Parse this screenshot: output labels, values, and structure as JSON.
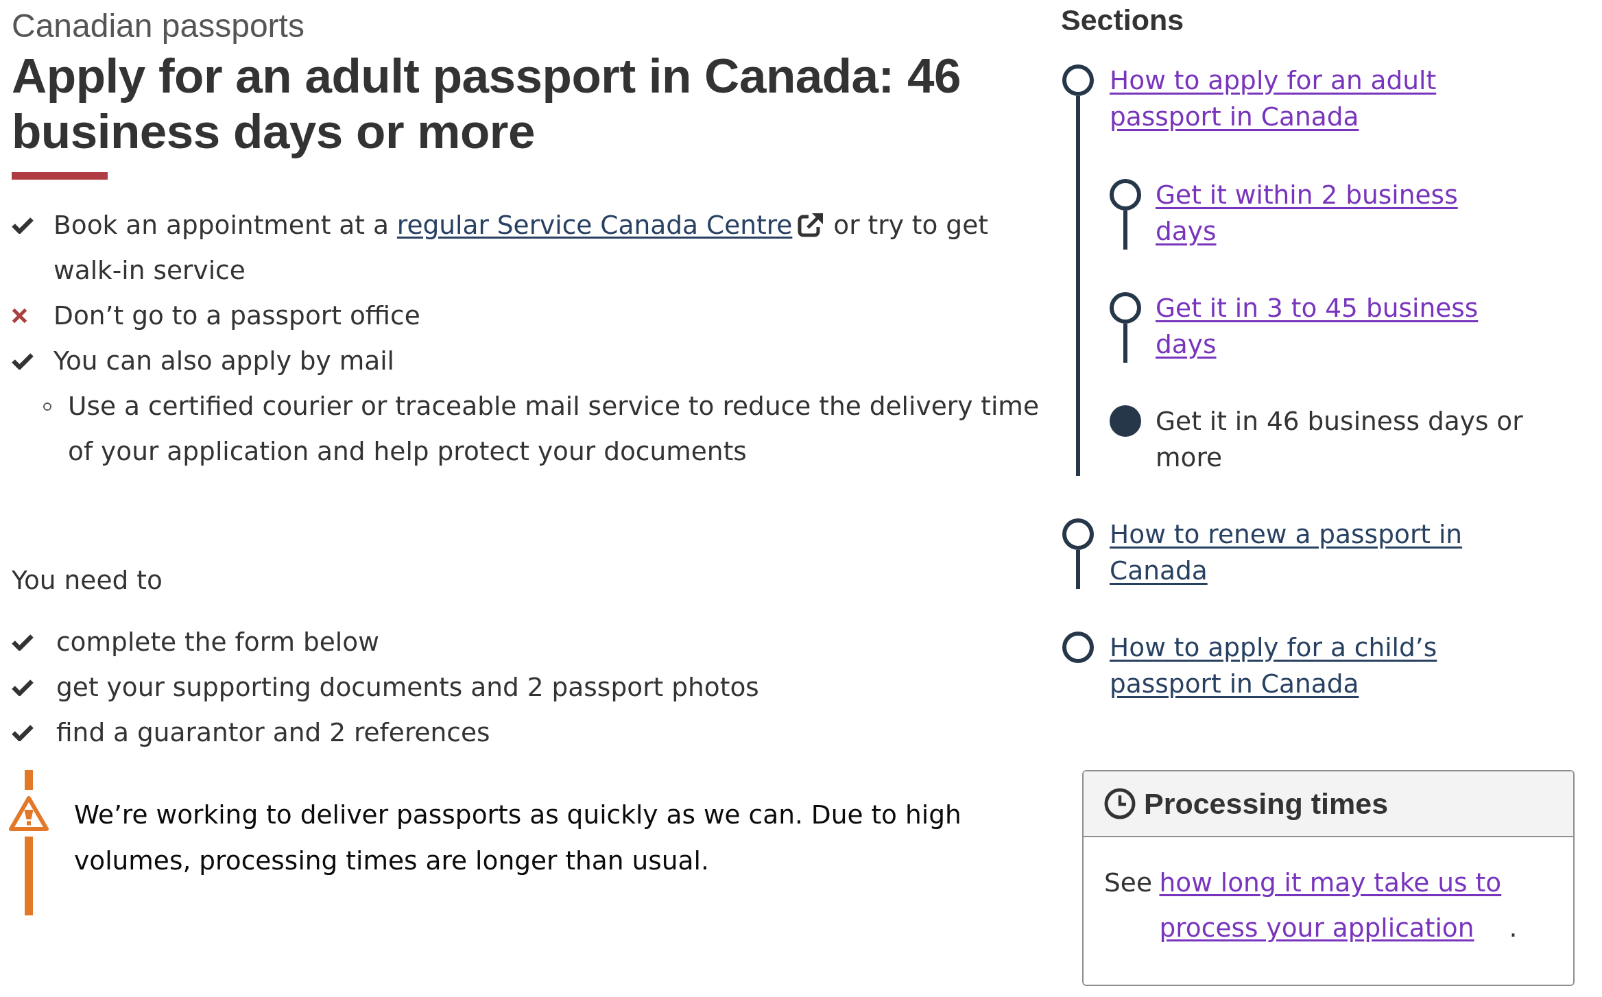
{
  "header": {
    "section": "Canadian passports",
    "title": "Apply for an adult passport in Canada: 46 business days or more"
  },
  "options": [
    {
      "kind": "check",
      "text": "Book an appointment at a ",
      "link": {
        "label": "regular Service Canada Centre",
        "visited": false,
        "external": true
      },
      "text_after": " or try to get walk-in service"
    },
    {
      "kind": "cross",
      "text": "Don’t go to a passport office"
    },
    {
      "kind": "check",
      "text": "You can also apply by mail",
      "children": [
        {
          "text": "Use a certified courier or traceable mail service to reduce the delivery time of your application and help protect your documents"
        }
      ]
    }
  ],
  "requirements": {
    "intro": "You need to",
    "items": [
      {
        "kind": "check",
        "text": "complete the form below"
      },
      {
        "kind": "check",
        "text": "get your supporting documents and 2 passport photos"
      },
      {
        "kind": "check",
        "text": "find a guarantor and 2 references"
      }
    ]
  },
  "alert": {
    "kind": "warning",
    "text": "We’re working to deliver passports as quickly as we can. Due to high volumes, processing times are longer than usual."
  },
  "sections": {
    "title": "Sections",
    "items": [
      {
        "label": "How to apply for an adult passport in Canada",
        "selected": false,
        "visited": true,
        "children": [
          {
            "label": "Get it within 2 business days",
            "selected": false,
            "visited": true
          },
          {
            "label": "Get it in 3 to 45 business days",
            "selected": false,
            "visited": true
          },
          {
            "label": "Get it in 46 business days or more",
            "selected": true
          }
        ]
      },
      {
        "label": "How to renew a passport in Canada",
        "selected": false,
        "visited": false
      },
      {
        "label": "How to apply for a child’s passport in Canada",
        "selected": false,
        "visited": false
      }
    ]
  },
  "processing": {
    "title": "Processing times",
    "text": "See ",
    "link": {
      "label": "how long it may take us to process your application",
      "visited": true
    },
    "text_after": "."
  }
}
